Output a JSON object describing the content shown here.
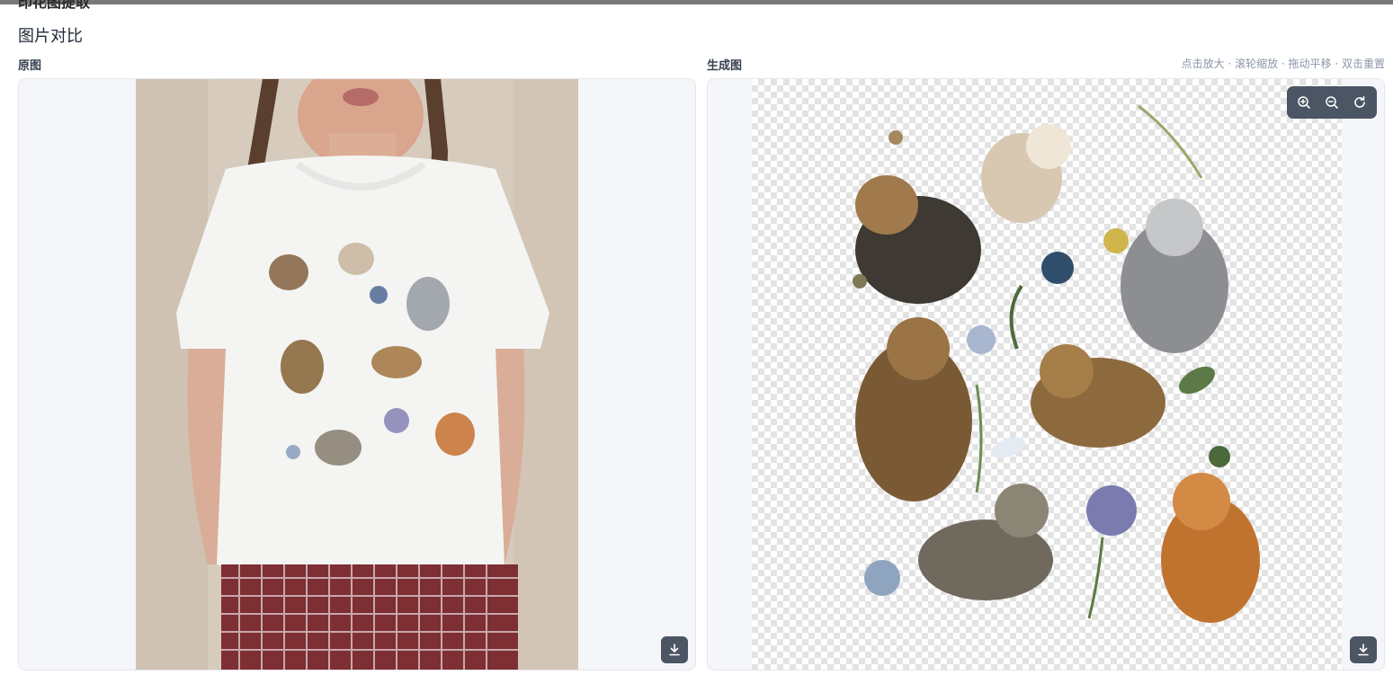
{
  "background_page": {
    "peek_title": "印花图提取"
  },
  "modal": {
    "title": "图片对比",
    "original_label": "原图",
    "generated_label": "生成图",
    "controls_hint": "点击放大 · 滚轮缩放 · 拖动平移 · 双击重置"
  },
  "toolbar": {
    "icons": [
      "zoom-in-icon",
      "zoom-out-icon",
      "reset-icon"
    ]
  },
  "download": {
    "icon": "download-icon"
  },
  "colors": {
    "panel_bg": "#f4f6fa",
    "control_bg": "#4b5563",
    "hint": "#8b95a7"
  }
}
